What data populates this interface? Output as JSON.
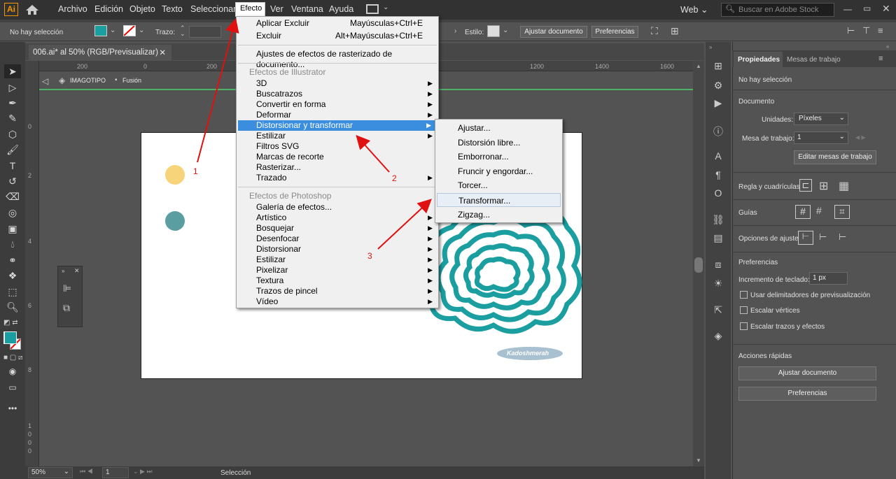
{
  "app": {
    "logo": "Ai"
  },
  "menubar": {
    "items": [
      "Archivo",
      "Edición",
      "Objeto",
      "Texto",
      "Seleccionar",
      "Efecto",
      "Ver",
      "Ventana",
      "Ayuda"
    ],
    "workspace": "Web",
    "search_placeholder": "Buscar en Adobe Stock"
  },
  "control_bar": {
    "selection": "No hay selección",
    "fill_color": "#1a9ea0",
    "stroke_label": "Trazo:",
    "style_label": "Estilo:",
    "fit_doc": "Ajustar documento",
    "prefs": "Preferencias"
  },
  "document": {
    "tab_title": "006.ai* al 50% (RGB/Previsualizar)",
    "breadcrumb_layer": "IMAGOTIPO",
    "breadcrumb_group": "Fusión",
    "ruler_h": [
      "200",
      "0",
      "200",
      "1200",
      "1400",
      "1600"
    ],
    "ruler_v": [
      "0",
      "2",
      "4",
      "6",
      "8",
      "1",
      "0",
      "0",
      "0"
    ],
    "signature": "Kadoshmerah",
    "colors": {
      "yellow": "#f7d37a",
      "teal_dot": "#5a9ea1",
      "teal": "#1a9ea0",
      "oval": "#a8c0cf"
    }
  },
  "effect_menu": {
    "apply": "Aplicar Excluir",
    "apply_sc": "Mayúsculas+Ctrl+E",
    "exclude": "Excluir",
    "exclude_sc": "Alt+Mayúsculas+Ctrl+E",
    "raster_settings": "Ajustes de efectos de rasterizado de documento...",
    "illustrator_header": "Efectos de Illustrator",
    "illustrator_items": [
      "3D",
      "Buscatrazos",
      "Convertir en forma",
      "Deformar",
      "Distorsionar y transformar",
      "Estilizar",
      "Filtros SVG",
      "Marcas de recorte",
      "Rasterizar...",
      "Trazado"
    ],
    "photoshop_header": "Efectos de Photoshop",
    "photoshop_items": [
      "Galería de efectos...",
      "Artístico",
      "Bosquejar",
      "Desenfocar",
      "Distorsionar",
      "Estilizar",
      "Pixelizar",
      "Textura",
      "Trazos de pincel",
      "Vídeo"
    ]
  },
  "submenu": {
    "items": [
      "Ajustar...",
      "Distorsión libre...",
      "Emborronar...",
      "Fruncir y engordar...",
      "Torcer...",
      "Transformar...",
      "Zigzag..."
    ]
  },
  "annotations": [
    "1",
    "2",
    "3"
  ],
  "status_bar": {
    "zoom": "50%",
    "page": "1",
    "tool": "Selección"
  },
  "properties": {
    "tab_properties": "Propiedades",
    "tab_artboards": "Mesas de trabajo",
    "no_selection": "No hay selección",
    "document_title": "Documento",
    "units_label": "Unidades:",
    "units_value": "Píxeles",
    "artboard_label": "Mesa de trabajo:",
    "artboard_value": "1",
    "edit_artboards": "Editar mesas de trabajo",
    "rulers_grids": "Regla y cuadrículas",
    "guides": "Guías",
    "snap_options": "Opciones de ajuste",
    "prefs_title": "Preferencias",
    "keyboard_inc_label": "Incremento de teclado:",
    "keyboard_inc_value": "1 px",
    "cb_preview_bounds": "Usar delimitadores de previsualización",
    "cb_scale_corners": "Escalar vértices",
    "cb_scale_strokes": "Escalar trazos y efectos",
    "quick_actions": "Acciones rápidas",
    "qa_fit": "Ajustar documento",
    "qa_prefs": "Preferencias"
  }
}
